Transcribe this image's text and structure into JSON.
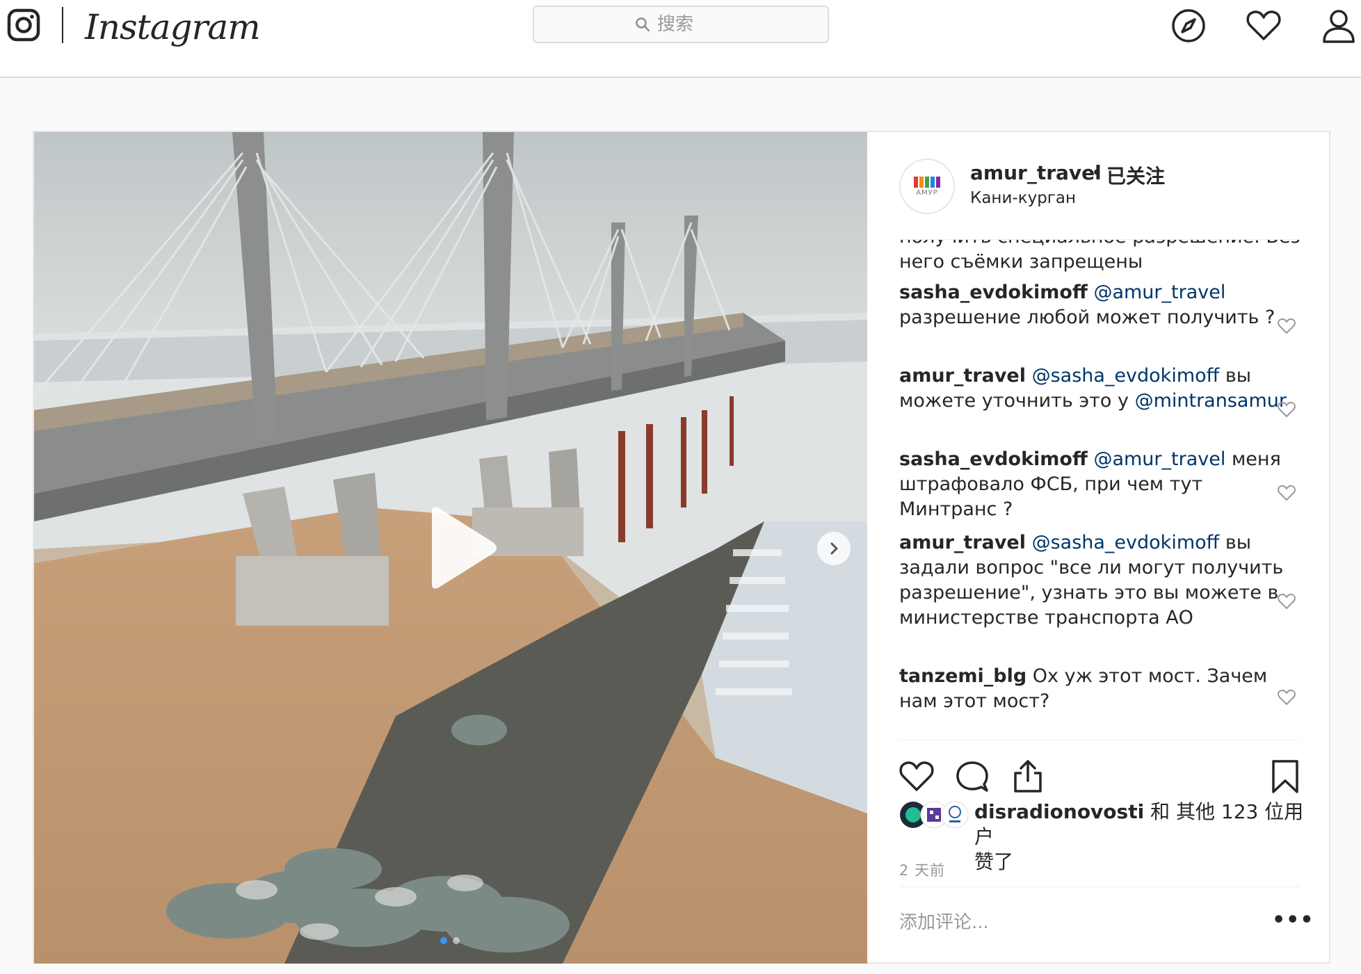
{
  "header": {
    "brand": "Instagram",
    "search_placeholder": "搜索",
    "icons": [
      "instagram-glyph-icon",
      "compass-icon",
      "heart-icon",
      "user-icon"
    ]
  },
  "post": {
    "author": {
      "username": "amur_travel",
      "separator": "•",
      "follow_status": "已关注",
      "location": "Кани-курган",
      "avatar_text": "АМУР"
    },
    "media": {
      "type": "video",
      "carousel_dots": 2,
      "active_dot": 1,
      "icons": [
        "play-icon",
        "chevron-right-icon"
      ]
    },
    "comments": [
      {
        "username": "",
        "text": "получить специальное разрешение. Без него съёмки запрещены",
        "mention": ""
      },
      {
        "username": "sasha_evdokimoff",
        "mention": "@amur_travel",
        "text": "разрешение любой может получить ?"
      },
      {
        "username": "amur_travel",
        "mention": "@sasha_evdokimoff",
        "text": "вы можете уточнить это у",
        "mention2": "@mintransamur"
      },
      {
        "username": "sasha_evdokimoff",
        "mention": "@amur_travel",
        "text": "меня штрафовало ФСБ, при чем тут Минтранс ?"
      },
      {
        "username": "amur_travel",
        "mention": "@sasha_evdokimoff",
        "text": "вы задали вопрос \"все ли могут получить разрешение\", узнать это вы можете в министерстве транспорта АО"
      },
      {
        "username": "tanzemi_blg",
        "mention": "",
        "text": "Ох уж этот мост. Зачем нам этот мост?"
      }
    ],
    "actions": [
      "heart-icon",
      "comment-icon",
      "share-icon",
      "bookmark-icon"
    ],
    "likes": {
      "first_user": "disradionovosti",
      "rest_text": "和 其他 123 位用户",
      "line2": "赞了"
    },
    "timestamp": "2 天前",
    "add_comment_placeholder": "添加评论...",
    "more_label": "•••"
  },
  "colors": {
    "link": "#003569",
    "text": "#262626",
    "muted": "#999999",
    "border": "#dbdbdb",
    "active_dot": "#3897f0"
  }
}
